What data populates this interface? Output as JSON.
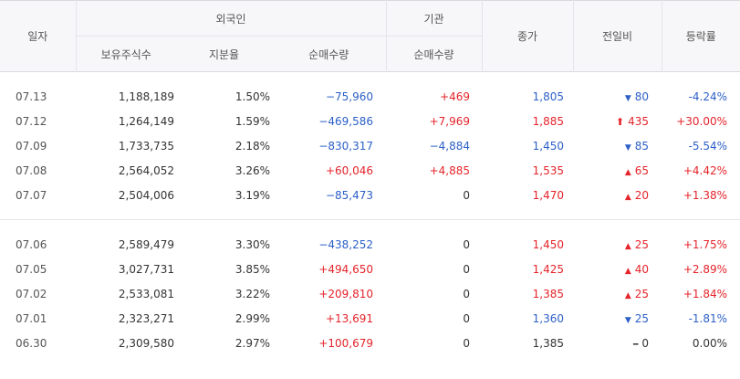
{
  "header": {
    "date": "일자",
    "foreign": "외국인",
    "institution": "기관",
    "close": "종가",
    "change": "전일비",
    "rate": "등락률",
    "holdings": "보유주식수",
    "ratio": "지분율",
    "foreign_net": "순매수량",
    "inst_net": "순매수량"
  },
  "colors": {
    "up": "#e5232a",
    "down": "#2c5fc7",
    "neutral": "#333333"
  },
  "groups": [
    {
      "rows": [
        {
          "date": "07.13",
          "holdings": "1,188,189",
          "ratio": "1.50%",
          "foreign_net": "−75,960",
          "foreign_dir": "down",
          "inst_net": "+469",
          "inst_dir": "up",
          "close": "1,805",
          "close_dir": "down",
          "change_icon": "down-triangle-icon",
          "change": "80",
          "change_dir": "down",
          "rate": "-4.24%",
          "rate_dir": "down"
        },
        {
          "date": "07.12",
          "holdings": "1,264,149",
          "ratio": "1.59%",
          "foreign_net": "−469,586",
          "foreign_dir": "down",
          "inst_net": "+7,969",
          "inst_dir": "up",
          "close": "1,885",
          "close_dir": "up",
          "change_icon": "upper-limit-arrow-icon",
          "change": "435",
          "change_dir": "up",
          "rate": "+30.00%",
          "rate_dir": "up"
        },
        {
          "date": "07.09",
          "holdings": "1,733,735",
          "ratio": "2.18%",
          "foreign_net": "−830,317",
          "foreign_dir": "down",
          "inst_net": "−4,884",
          "inst_dir": "down",
          "close": "1,450",
          "close_dir": "down",
          "change_icon": "down-triangle-icon",
          "change": "85",
          "change_dir": "down",
          "rate": "-5.54%",
          "rate_dir": "down"
        },
        {
          "date": "07.08",
          "holdings": "2,564,052",
          "ratio": "3.26%",
          "foreign_net": "+60,046",
          "foreign_dir": "up",
          "inst_net": "+4,885",
          "inst_dir": "up",
          "close": "1,535",
          "close_dir": "up",
          "change_icon": "up-triangle-icon",
          "change": "65",
          "change_dir": "up",
          "rate": "+4.42%",
          "rate_dir": "up"
        },
        {
          "date": "07.07",
          "holdings": "2,504,006",
          "ratio": "3.19%",
          "foreign_net": "−85,473",
          "foreign_dir": "down",
          "inst_net": "0",
          "inst_dir": "flat",
          "close": "1,470",
          "close_dir": "up",
          "change_icon": "up-triangle-icon",
          "change": "20",
          "change_dir": "up",
          "rate": "+1.38%",
          "rate_dir": "up"
        }
      ]
    },
    {
      "rows": [
        {
          "date": "07.06",
          "holdings": "2,589,479",
          "ratio": "3.30%",
          "foreign_net": "−438,252",
          "foreign_dir": "down",
          "inst_net": "0",
          "inst_dir": "flat",
          "close": "1,450",
          "close_dir": "up",
          "change_icon": "up-triangle-icon",
          "change": "25",
          "change_dir": "up",
          "rate": "+1.75%",
          "rate_dir": "up"
        },
        {
          "date": "07.05",
          "holdings": "3,027,731",
          "ratio": "3.85%",
          "foreign_net": "+494,650",
          "foreign_dir": "up",
          "inst_net": "0",
          "inst_dir": "flat",
          "close": "1,425",
          "close_dir": "up",
          "change_icon": "up-triangle-icon",
          "change": "40",
          "change_dir": "up",
          "rate": "+2.89%",
          "rate_dir": "up"
        },
        {
          "date": "07.02",
          "holdings": "2,533,081",
          "ratio": "3.22%",
          "foreign_net": "+209,810",
          "foreign_dir": "up",
          "inst_net": "0",
          "inst_dir": "flat",
          "close": "1,385",
          "close_dir": "up",
          "change_icon": "up-triangle-icon",
          "change": "25",
          "change_dir": "up",
          "rate": "+1.84%",
          "rate_dir": "up"
        },
        {
          "date": "07.01",
          "holdings": "2,323,271",
          "ratio": "2.99%",
          "foreign_net": "+13,691",
          "foreign_dir": "up",
          "inst_net": "0",
          "inst_dir": "flat",
          "close": "1,360",
          "close_dir": "down",
          "change_icon": "down-triangle-icon",
          "change": "25",
          "change_dir": "down",
          "rate": "-1.81%",
          "rate_dir": "down"
        },
        {
          "date": "06.30",
          "holdings": "2,309,580",
          "ratio": "2.97%",
          "foreign_net": "+100,679",
          "foreign_dir": "up",
          "inst_net": "0",
          "inst_dir": "flat",
          "close": "1,385",
          "close_dir": "flat",
          "change_icon": "dash-icon",
          "change": "0",
          "change_dir": "flat",
          "rate": "0.00%",
          "rate_dir": "flat"
        }
      ]
    }
  ]
}
